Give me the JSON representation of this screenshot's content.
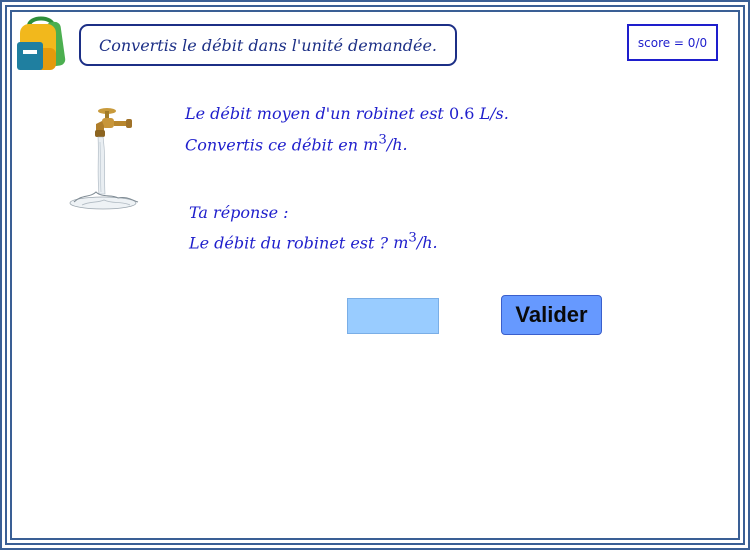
{
  "header": {
    "instruction": "Convertis le débit dans l'unité demandée.",
    "score_label": "score = 0/0"
  },
  "question": {
    "line1_prefix": "Le débit moyen d'un robinet est",
    "line1_value": "0.6",
    "line1_unit": "L/s.",
    "line2_prefix": "Convertis ce débit en",
    "line2_unit_base": "m",
    "line2_unit_exp": "3",
    "line2_unit_suffix": "/h."
  },
  "answer": {
    "label": "Ta réponse :",
    "line_prefix": "Le débit du robinet est ?",
    "unit_base": "m",
    "unit_exp": "3",
    "unit_suffix": "/h.",
    "input_value": ""
  },
  "buttons": {
    "submit_label": "Valider"
  },
  "icons": {
    "app_icon": "backpack-icon",
    "illustration": "faucet-icon"
  },
  "colors": {
    "frame": "#3a5f95",
    "text": "#1e1ecc",
    "input_bg": "#99ccff",
    "button_bg": "#6699ff"
  }
}
